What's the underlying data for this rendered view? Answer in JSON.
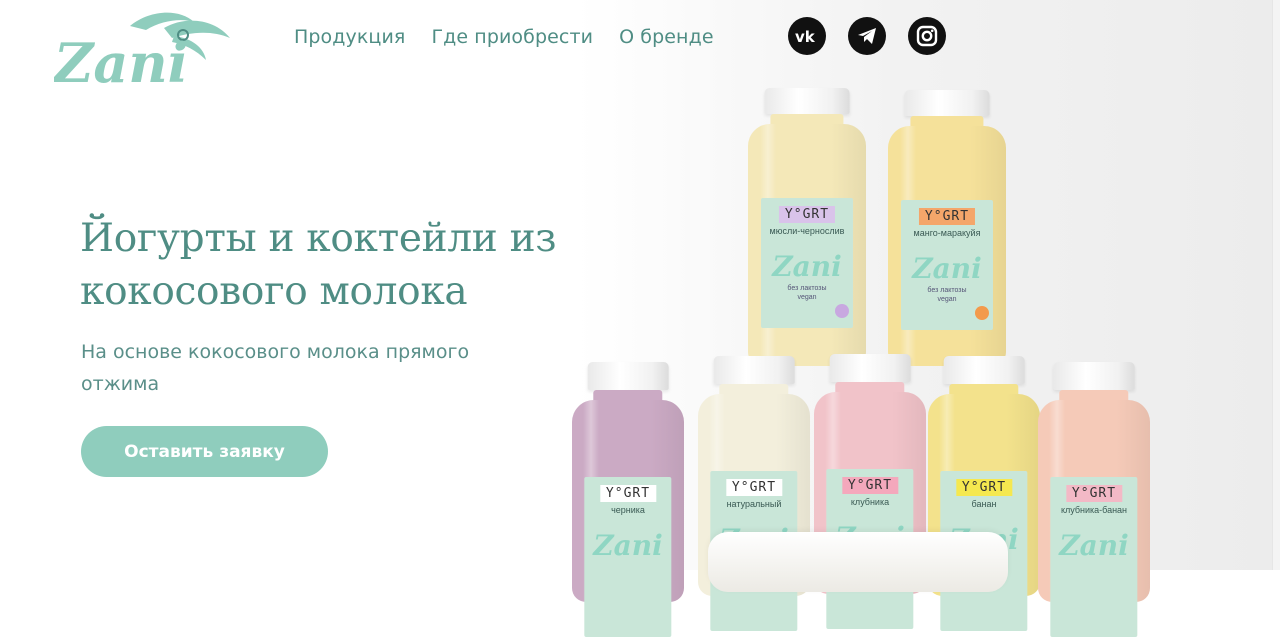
{
  "brand": {
    "logo_text": "Zani",
    "color": "#4f8d84",
    "accent": "#8fcdbd"
  },
  "nav": {
    "items": [
      "Продукция",
      "Где приобрести",
      "О бренде"
    ]
  },
  "socials": [
    {
      "name": "vk-icon",
      "glyph": "vk"
    },
    {
      "name": "telegram-icon",
      "glyph": ""
    },
    {
      "name": "instagram-icon",
      "glyph": ""
    }
  ],
  "hero": {
    "title": "Йогурты и коктейли из кокосового молока",
    "subtitle": "На основе кокосового молока прямого отжима",
    "cta_label": "Оставить заявку"
  },
  "products": {
    "brand_label": "Y°GRT",
    "logo_label": "Zani",
    "note": "без лактозы",
    "vegan": "vegan",
    "top": [
      {
        "flavor": "мюсли-чернослив",
        "liquid": "#f4e8b8",
        "tag": "#d9c3ea",
        "dot": "#c8a8e0"
      },
      {
        "flavor": "манго-маракуйя",
        "liquid": "#f5e19a",
        "tag": "#f4a66a",
        "dot": "#f39a4b"
      }
    ],
    "bottom": [
      {
        "flavor": "черника",
        "liquid": "#cbaac4",
        "tag": "#ffffff"
      },
      {
        "flavor": "натуральный",
        "liquid": "#f3efdc",
        "tag": "#ffffff"
      },
      {
        "flavor": "клубника",
        "liquid": "#f1c3c9",
        "tag": "#f4a8bc"
      },
      {
        "flavor": "банан",
        "liquid": "#f3e28c",
        "tag": "#f5e84f"
      },
      {
        "flavor": "клубника-банан",
        "liquid": "#f5cab8",
        "tag": "#f3b9c6"
      }
    ]
  }
}
